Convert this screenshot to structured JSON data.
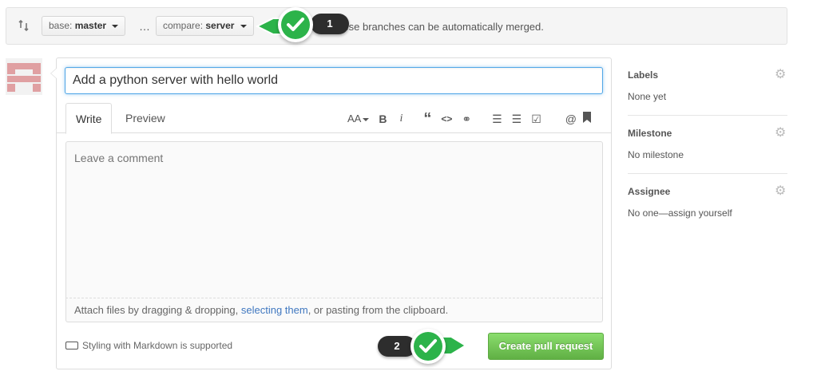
{
  "range": {
    "base_prefix": "base:",
    "base_branch": "master",
    "dots": "…",
    "compare_prefix": "compare:",
    "compare_branch": "server",
    "merge_status_visible": "e.",
    "merge_message": "These branches can be automatically merged."
  },
  "callouts": {
    "step1": "1",
    "step2": "2"
  },
  "form": {
    "title_value": "Add a python server with hello world",
    "tabs": {
      "write": "Write",
      "preview": "Preview"
    },
    "comment_placeholder": "Leave a comment",
    "attach": {
      "before": "Attach files by dragging & dropping, ",
      "link": "selecting them",
      "after": ", or pasting from the clipboard."
    },
    "markdown_note": "Styling with Markdown is supported",
    "create_button": "Create pull request"
  },
  "toolbar": {
    "header": "AA",
    "bold": "B",
    "italic": "i",
    "quote": "“",
    "code": "<>",
    "link": "⚭",
    "ul": "☰",
    "ol": "☰",
    "task": "☑",
    "mention": "@",
    "bookmark": "▮"
  },
  "sidebar": {
    "labels": {
      "title": "Labels",
      "value": "None yet"
    },
    "milestone": {
      "title": "Milestone",
      "value": "No milestone"
    },
    "assignee": {
      "title": "Assignee",
      "value": "No one—assign yourself"
    }
  },
  "colors": {
    "accent_green": "#2cb34a",
    "button_green": "#60b044",
    "link_blue": "#4078c0",
    "focus_blue": "#51a7e8"
  },
  "icons": [
    "compare-icon",
    "check-icon",
    "gear-icon",
    "markdown-icon",
    "avatar"
  ]
}
